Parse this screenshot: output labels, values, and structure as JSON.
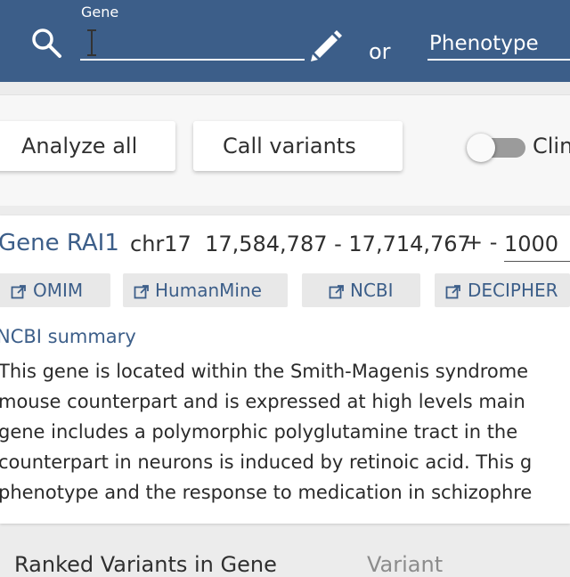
{
  "search": {
    "gene_label": "Gene",
    "gene_value": "",
    "or_label": "or",
    "phenotype_link": "Phenotype"
  },
  "toolbar": {
    "analyze_all": "Analyze all",
    "call_variants": "Call variants",
    "toggle_label": "Clin",
    "toggle_on": false
  },
  "gene": {
    "title": "Gene RAI1",
    "coordinates": "chr17  17,584,787 - 17,714,767",
    "plus_minus": "+ -",
    "range": "1000",
    "links": [
      "OMIM",
      "HumanMine",
      "NCBI",
      "DECIPHER"
    ],
    "summary_title": "NCBI summary",
    "summary_lines": [
      "This gene is located within the Smith-Magenis syndrome",
      "mouse counterpart and is expressed at high levels main",
      "gene includes a polymorphic polyglutamine tract in the",
      "counterpart in neurons is induced by retinoic acid. This g",
      "phenotype and the response to medication in schizophre"
    ]
  },
  "tabs": {
    "ranked": "Ranked Variants in Gene",
    "variant": "Variant"
  },
  "colors": {
    "header_bg": "#3c5e89",
    "link": "#3c5e89",
    "chip_bg": "#e8e8e8"
  }
}
